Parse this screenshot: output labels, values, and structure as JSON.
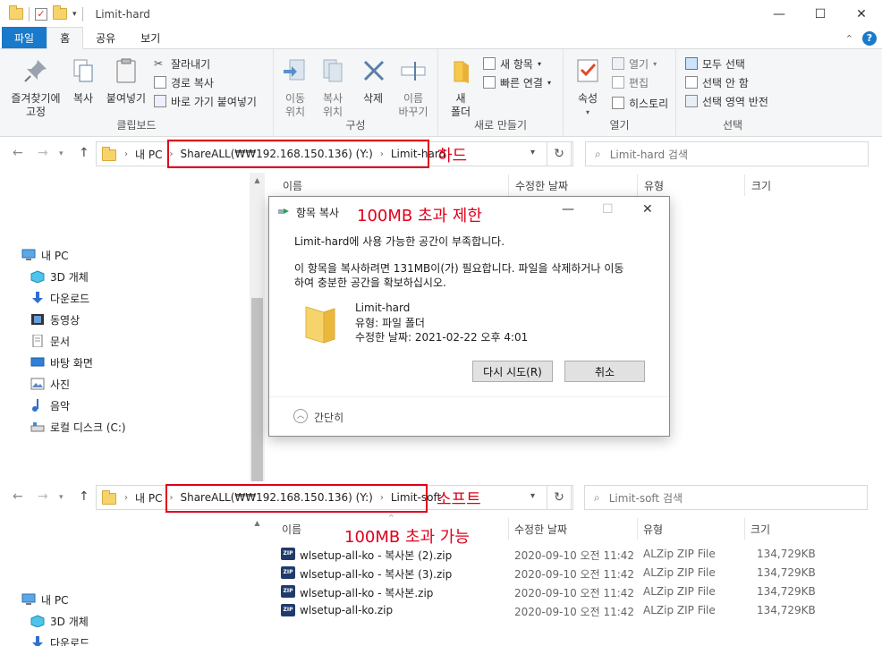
{
  "window": {
    "title": "Limit-hard",
    "minimize": "—",
    "maximize": "☐",
    "close": "✕"
  },
  "ribbon_tabs": [
    "파일",
    "홈",
    "공유",
    "보기"
  ],
  "ribbon": {
    "clipboard": {
      "pin": "즐겨찾기에\n고정",
      "copy": "복사",
      "paste": "붙여넣기",
      "cut": "잘라내기",
      "copy_path": "경로 복사",
      "paste_shortcut": "바로 가기 붙여넣기",
      "label": "클립보드"
    },
    "organize": {
      "move_to": "이동\n위치",
      "copy_to": "복사\n위치",
      "delete": "삭제",
      "rename": "이름\n바꾸기",
      "label": "구성"
    },
    "new": {
      "new_folder": "새\n폴더",
      "new_item": "새 항목",
      "easy_access": "빠른 연결",
      "label": "새로 만들기"
    },
    "open": {
      "properties": "속성",
      "open": "열기",
      "edit": "편집",
      "history": "히스토리",
      "label": "열기"
    },
    "select": {
      "select_all": "모두 선택",
      "select_none": "선택 안 함",
      "invert": "선택 영역 반전",
      "label": "선택"
    }
  },
  "top_pane": {
    "breadcrumbs": [
      "내 PC",
      "ShareALL(₩₩192.168.150.136) (Y:)",
      "Limit-hard"
    ],
    "annotation": "하드",
    "search_placeholder": "Limit-hard 검색",
    "columns": [
      "이름",
      "수정한 날짜",
      "유형",
      "크기"
    ],
    "nav_items": [
      {
        "label": "내 PC",
        "icon": "pc-icon"
      },
      {
        "label": "3D 개체",
        "icon": "3d-objects-icon"
      },
      {
        "label": "다운로드",
        "icon": "download-icon"
      },
      {
        "label": "동영상",
        "icon": "video-icon"
      },
      {
        "label": "문서",
        "icon": "document-icon"
      },
      {
        "label": "바탕 화면",
        "icon": "desktop-icon"
      },
      {
        "label": "사진",
        "icon": "pictures-icon"
      },
      {
        "label": "음악",
        "icon": "music-icon"
      },
      {
        "label": "로컬 디스크 (C:)",
        "icon": "drive-icon"
      }
    ]
  },
  "bottom_pane": {
    "breadcrumbs": [
      "내 PC",
      "ShareALL(₩₩192.168.150.136) (Y:)",
      "Limit-soft"
    ],
    "annotation_location": "소프트",
    "annotation_note": "100MB 초과 가능",
    "search_placeholder": "Limit-soft 검색",
    "columns": [
      "이름",
      "수정한 날짜",
      "유형",
      "크기"
    ],
    "files": [
      {
        "name": "wlsetup-all-ko - 복사본 (2).zip",
        "date": "2020-09-10 오전 11:42",
        "type": "ALZip ZIP File",
        "size": "134,729KB"
      },
      {
        "name": "wlsetup-all-ko - 복사본 (3).zip",
        "date": "2020-09-10 오전 11:42",
        "type": "ALZip ZIP File",
        "size": "134,729KB"
      },
      {
        "name": "wlsetup-all-ko - 복사본.zip",
        "date": "2020-09-10 오전 11:42",
        "type": "ALZip ZIP File",
        "size": "134,729KB"
      },
      {
        "name": "wlsetup-all-ko.zip",
        "date": "2020-09-10 오전 11:42",
        "type": "ALZip ZIP File",
        "size": "134,729KB"
      }
    ],
    "nav_items": [
      {
        "label": "내 PC",
        "icon": "pc-icon"
      },
      {
        "label": "3D 개체",
        "icon": "3d-objects-icon"
      },
      {
        "label": "다운로드",
        "icon": "download-icon"
      }
    ]
  },
  "dialog": {
    "title": "항목 복사",
    "annotation": "100MB 초과 제한",
    "message1": "Limit-hard에 사용 가능한 공간이 부족합니다.",
    "message2": "이 항목을 복사하려면 131MB이(가) 필요합니다. 파일을 삭제하거나 이동",
    "message3": "하여 충분한 공간을 확보하십시오.",
    "item_name": "Limit-hard",
    "item_type": "유형: 파일 폴더",
    "item_date": "수정한 날짜: 2021-02-22 오후 4:01",
    "retry": "다시 시도(R)",
    "cancel": "취소",
    "collapse": "간단히"
  },
  "colors": {
    "accent": "#1979ca",
    "annotation_red": "#e0001b",
    "folder_yellow": "#f7d36b"
  }
}
